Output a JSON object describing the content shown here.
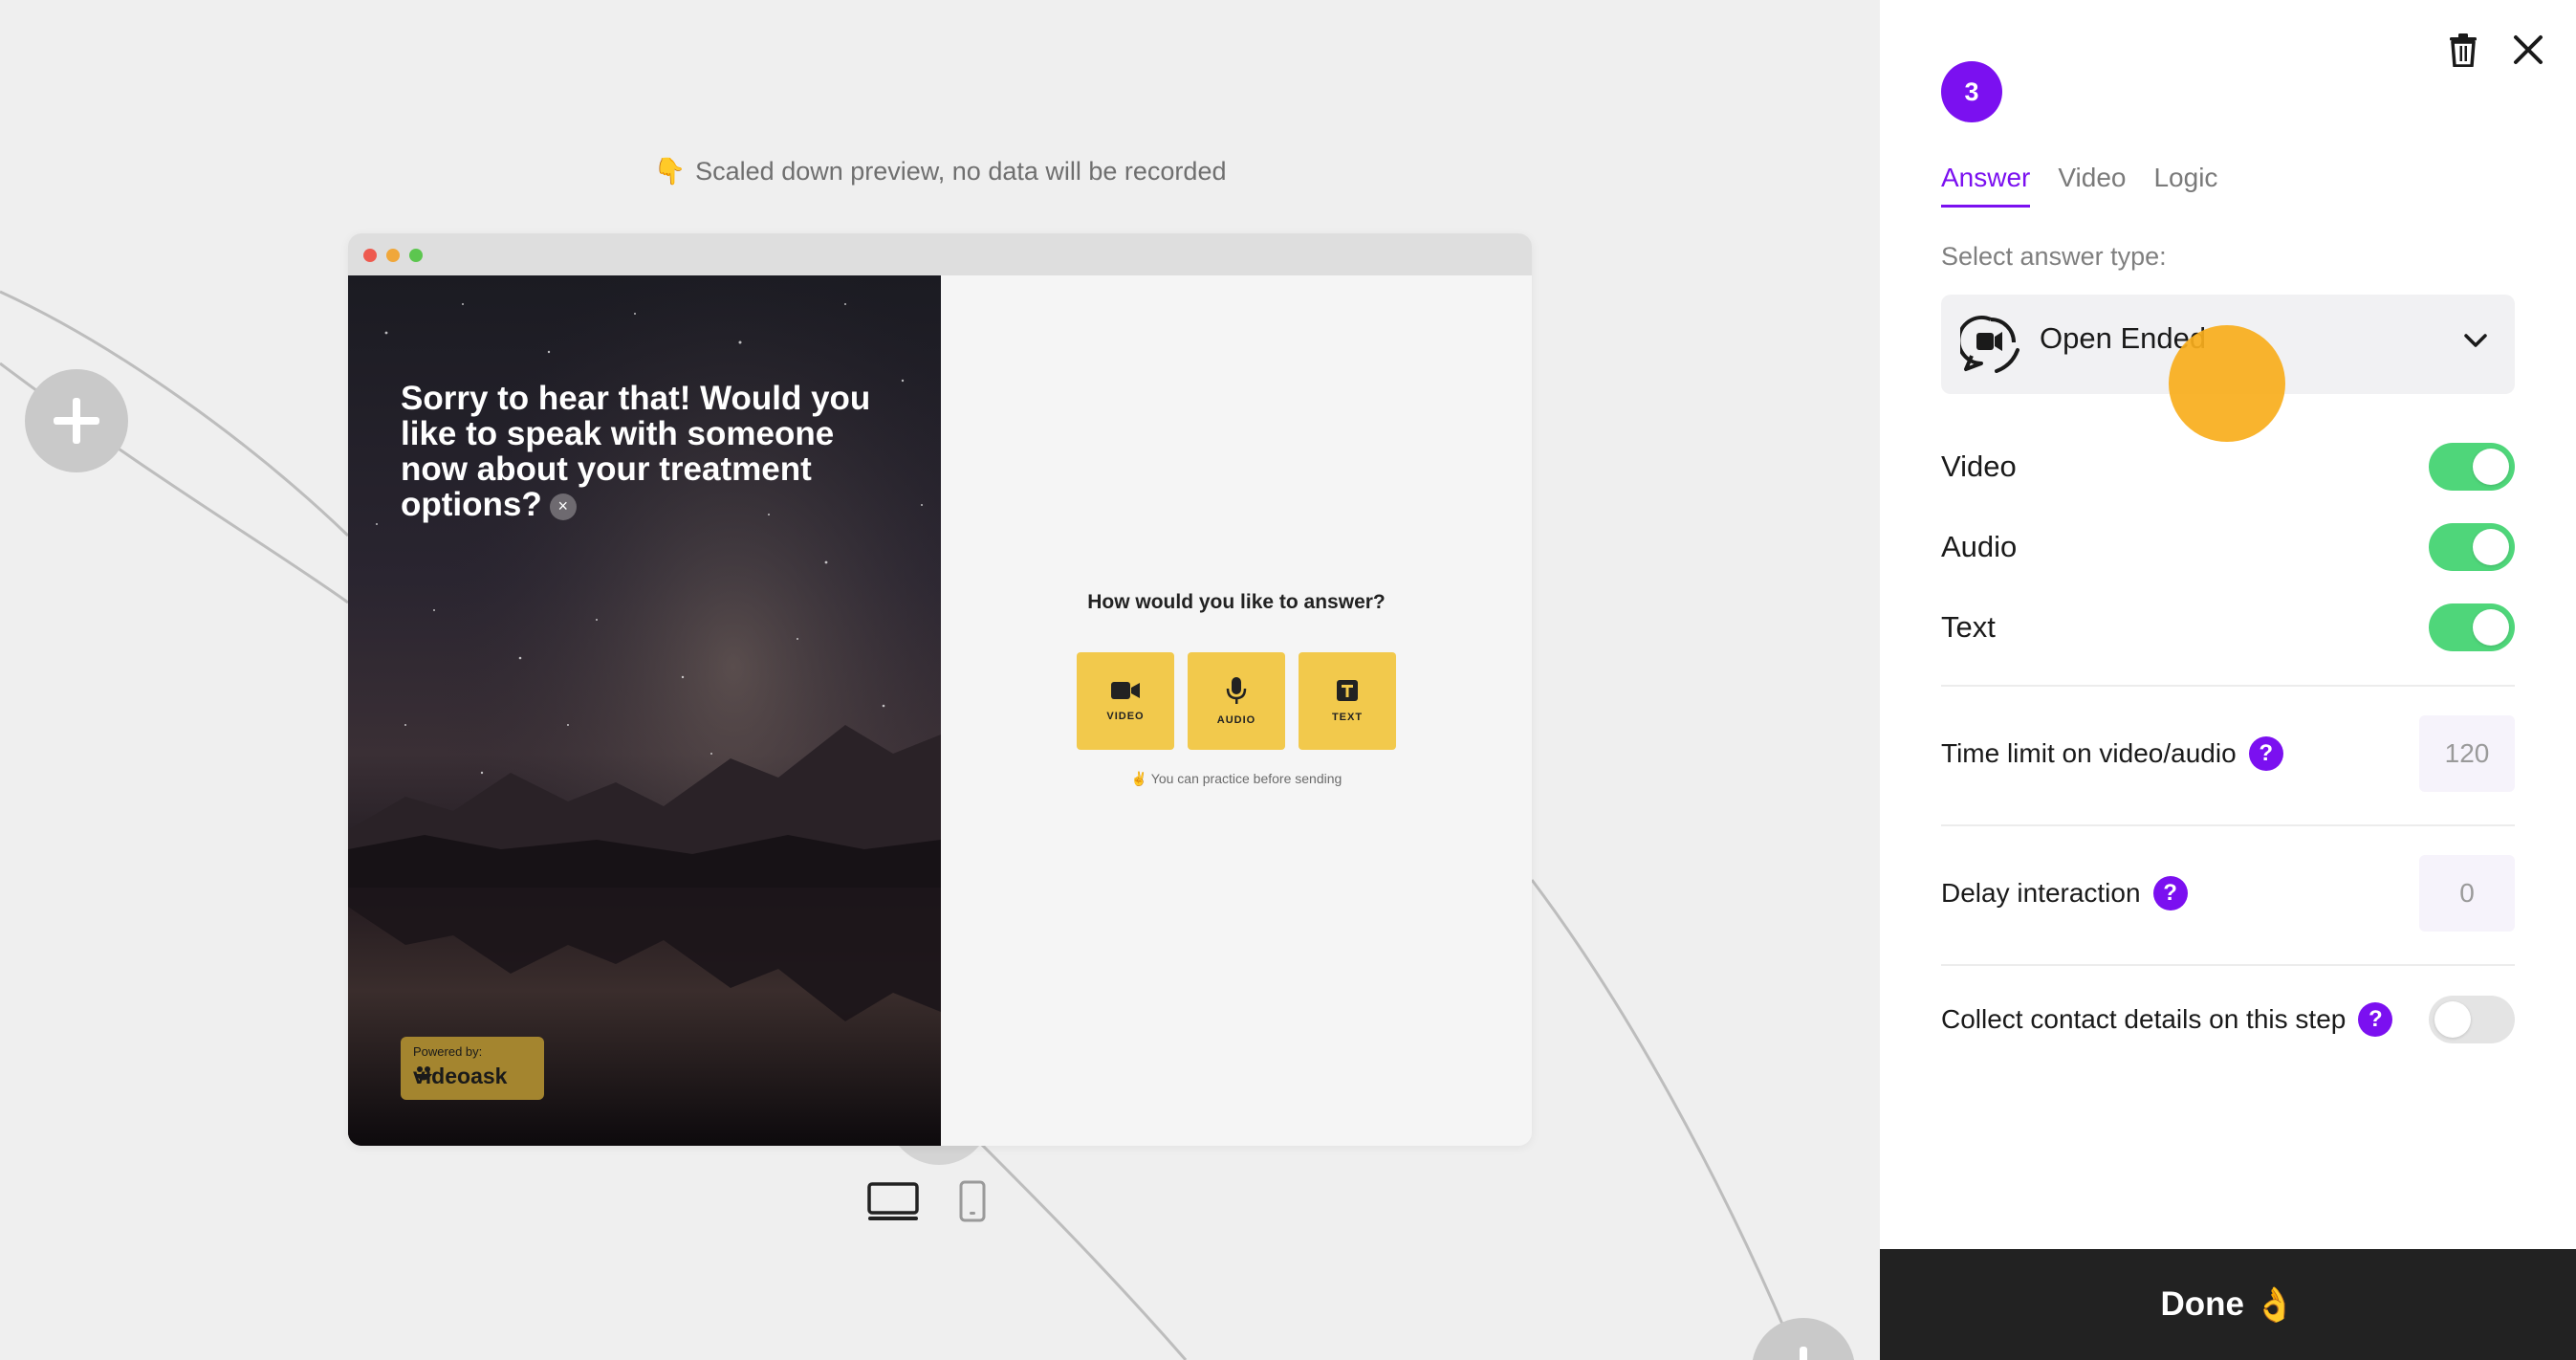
{
  "canvas": {
    "preview_note": "Scaled down preview, no data will be recorded",
    "preview_note_emoji": "👇"
  },
  "preview": {
    "question": "Sorry to hear that! Would you like to speak with someone now about your treatment options?",
    "question_close": "×",
    "powered_by_label": "Powered by:",
    "brand_name": "videoask",
    "answer_prompt": "How would you like to answer?",
    "answer_options": [
      {
        "label": "VIDEO",
        "icon": "video-camera-icon"
      },
      {
        "label": "AUDIO",
        "icon": "microphone-icon"
      },
      {
        "label": "TEXT",
        "icon": "text-icon"
      }
    ],
    "practice_note": "✌️ You can practice before sending",
    "device_views": [
      "desktop-icon",
      "mobile-icon"
    ]
  },
  "panel": {
    "step_number": "3",
    "tabs": [
      "Answer",
      "Video",
      "Logic"
    ],
    "active_tab": "Answer",
    "select_label": "Select answer type:",
    "select_value": "Open Ended",
    "toggles": [
      {
        "label": "Video",
        "on": true
      },
      {
        "label": "Audio",
        "on": true
      },
      {
        "label": "Text",
        "on": true
      }
    ],
    "time_limit": {
      "label": "Time limit on video/audio",
      "value": "120"
    },
    "delay": {
      "label": "Delay interaction",
      "value": "0"
    },
    "collect_contact": {
      "label": "Collect contact details on this step",
      "on": false
    },
    "help_glyph": "?",
    "done_label": "Done",
    "done_emoji": "👌"
  },
  "colors": {
    "accent": "#7b10f0",
    "toggle_on": "#4fd67a",
    "answer_tile": "#f2c94c",
    "cursor_highlight": "#f8ae1c",
    "done_bg": "#222222"
  }
}
